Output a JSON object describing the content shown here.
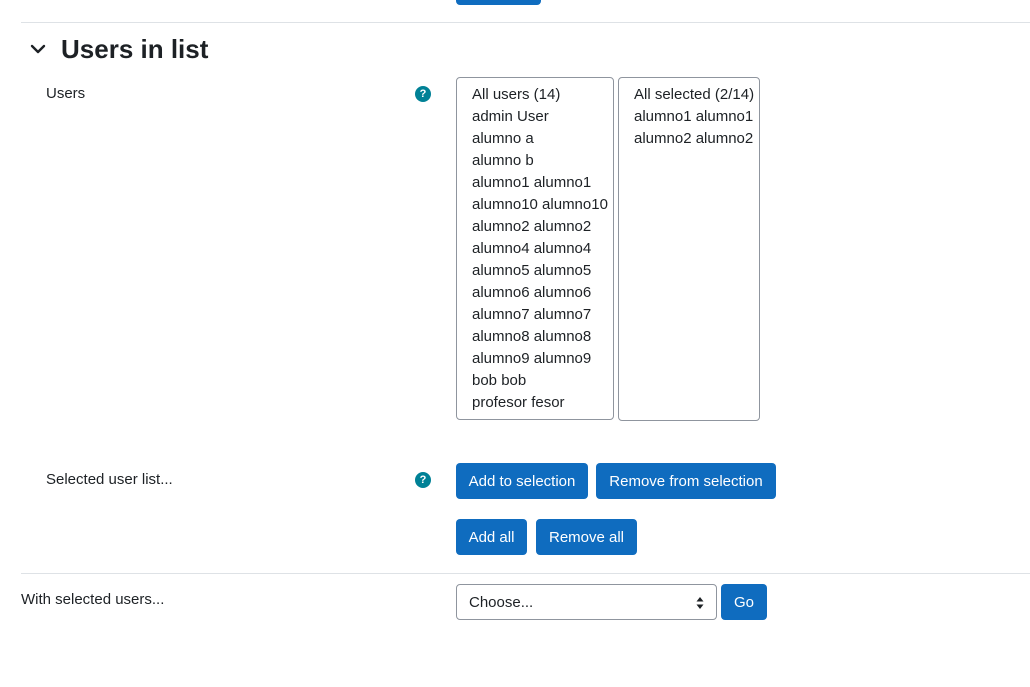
{
  "section": {
    "title": "Users in list"
  },
  "users_field": {
    "label": "Users",
    "help_icon": "question-icon",
    "available": {
      "header": "All users (14)",
      "options": [
        "admin User",
        "alumno a",
        "alumno b",
        "alumno1 alumno1",
        "alumno10 alumno10",
        "alumno2 alumno2",
        "alumno4 alumno4",
        "alumno5 alumno5",
        "alumno6 alumno6",
        "alumno7 alumno7",
        "alumno8 alumno8",
        "alumno9 alumno9",
        "bob bob",
        "profesor fesor"
      ]
    },
    "selected": {
      "header": "All selected (2/14)",
      "options": [
        "alumno1 alumno1",
        "alumno2 alumno2"
      ]
    }
  },
  "selected_list": {
    "label": "Selected user list...",
    "help_icon": "question-icon",
    "add_to_selection": "Add to selection",
    "remove_from_selection": "Remove from selection",
    "add_all": "Add all",
    "remove_all": "Remove all"
  },
  "bulk_action": {
    "label": "With selected users...",
    "select_value": "Choose...",
    "go": "Go"
  },
  "colors": {
    "primary": "#0f6cbf",
    "help": "#008196",
    "text": "#1d2125",
    "border": "#8f959e"
  }
}
